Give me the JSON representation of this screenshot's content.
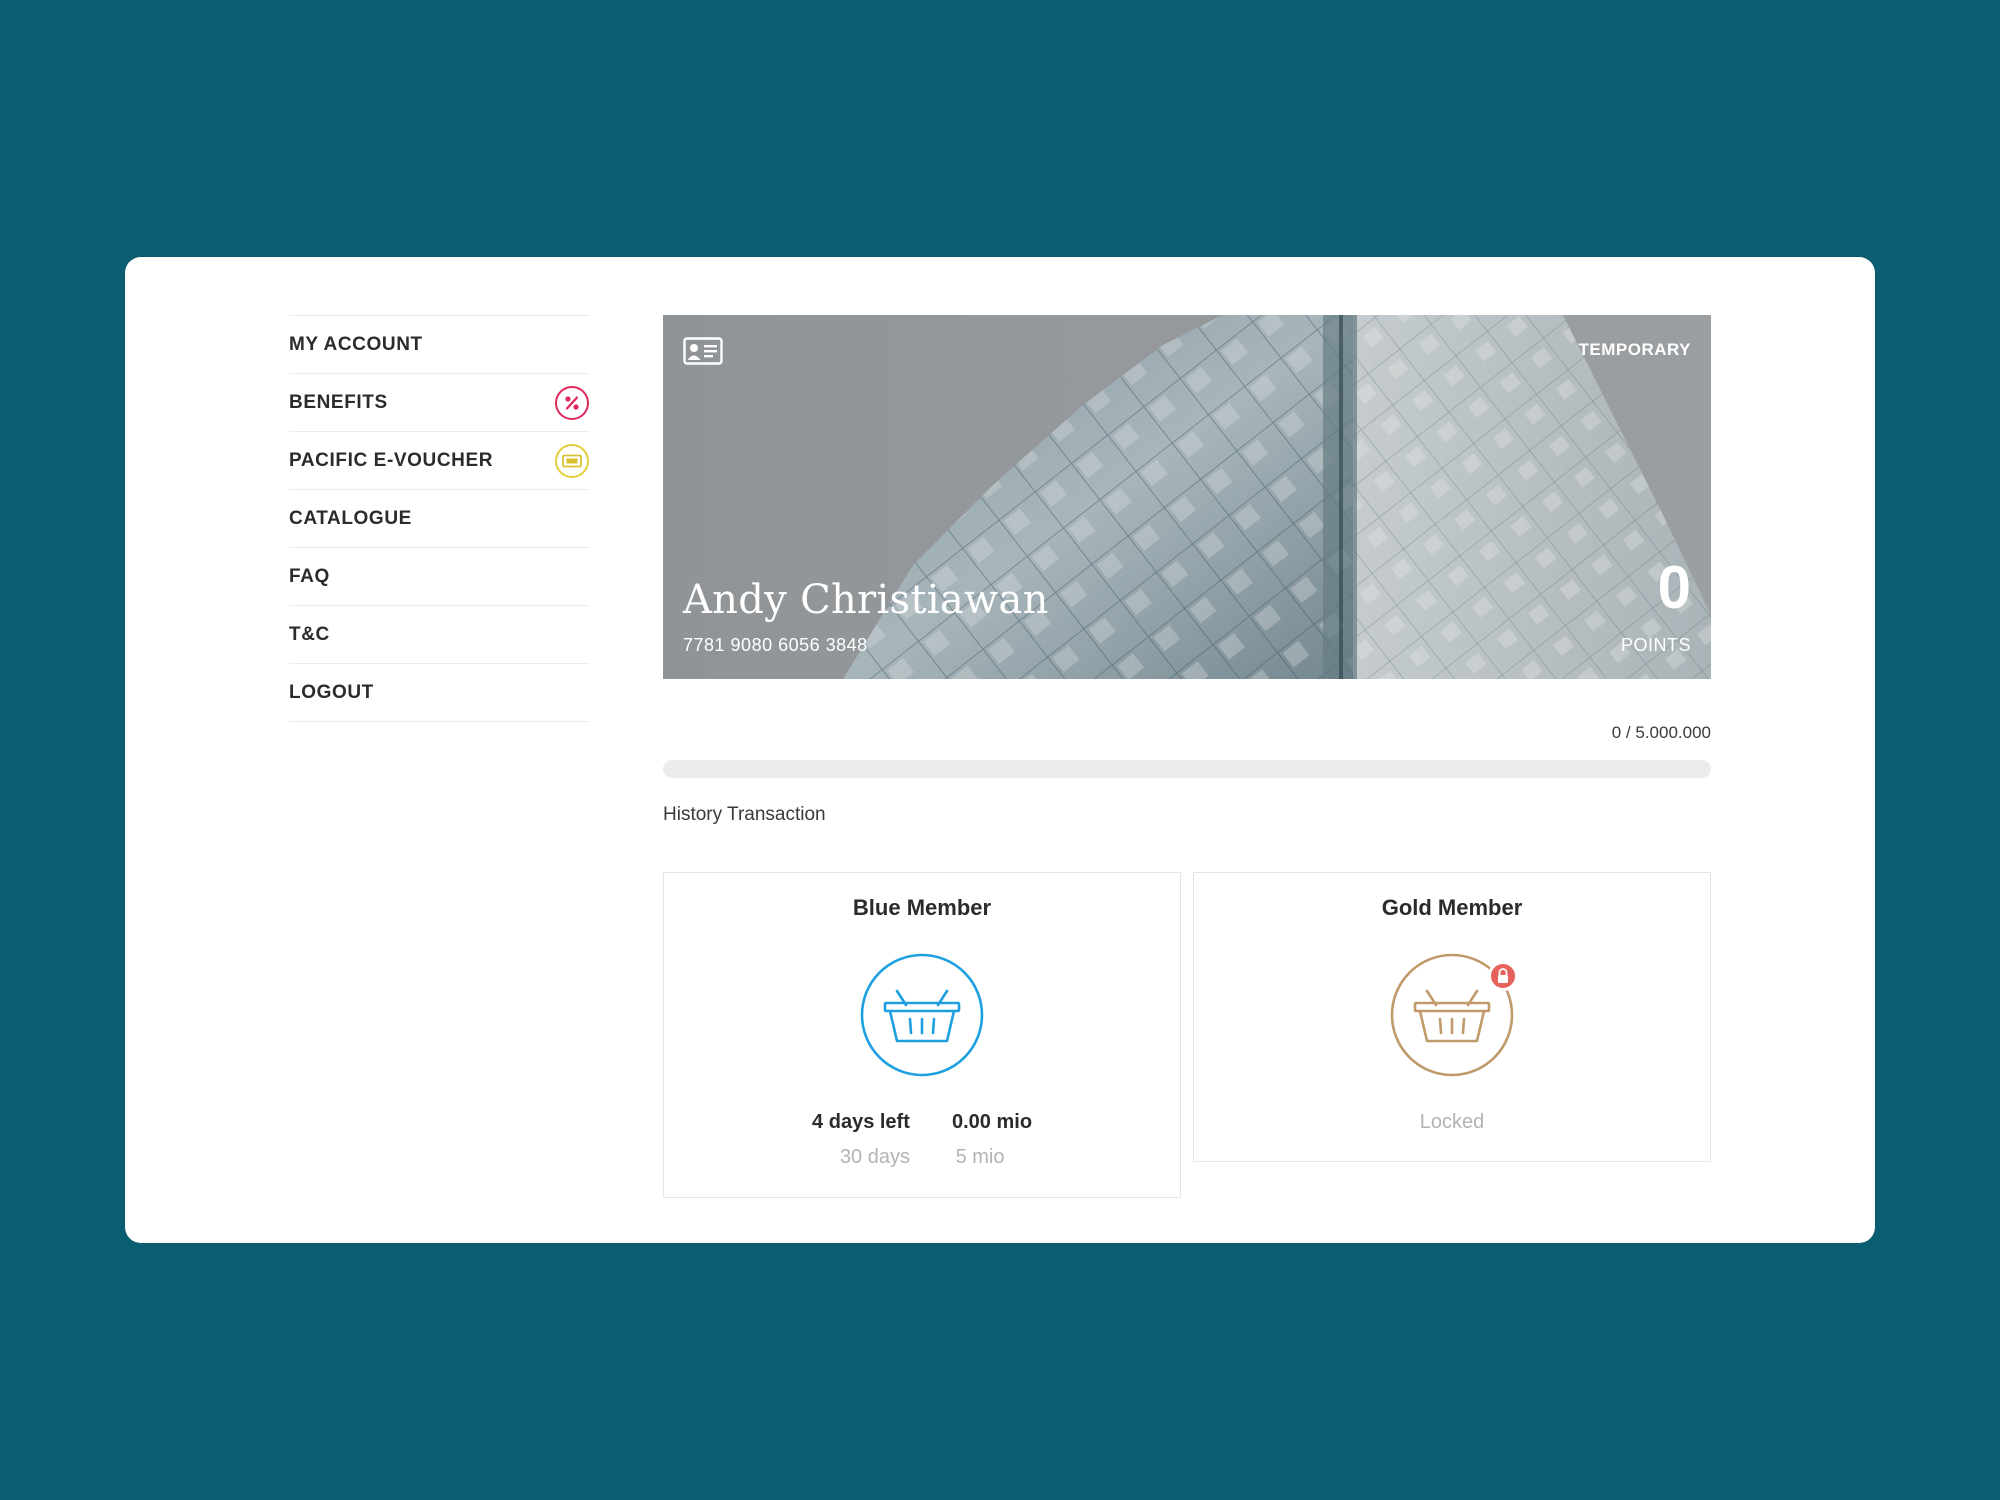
{
  "sidebar": {
    "items": [
      {
        "label": "MY ACCOUNT"
      },
      {
        "label": "BENEFITS",
        "icon": "percent-icon"
      },
      {
        "label": "PACIFIC E-VOUCHER",
        "icon": "voucher-ticket-icon"
      },
      {
        "label": "CATALOGUE"
      },
      {
        "label": "FAQ"
      },
      {
        "label": "T&C"
      },
      {
        "label": "LOGOUT"
      }
    ]
  },
  "card": {
    "status": "TEMPORARY",
    "name": "Andy Christiawan",
    "number": "7781 9080 6056 3848",
    "points_value": "0",
    "points_label": "POINTS"
  },
  "progress": {
    "text": "0 / 5.000.000",
    "fraction": 0
  },
  "history_link": "History Transaction",
  "tiers": {
    "blue": {
      "title": "Blue Member",
      "color": "#1ea0e0",
      "days_left": "4 days left",
      "days_total": "30 days",
      "amount": "0.00 mio",
      "amount_target": "5 mio"
    },
    "gold": {
      "title": "Gold Member",
      "color": "#c19a6b",
      "status": "Locked"
    }
  },
  "colors": {
    "background": "#0b5d72",
    "benefits_badge": "#e0285a",
    "voucher_badge": "#e3cf3a",
    "lock_badge": "#e5635a"
  }
}
